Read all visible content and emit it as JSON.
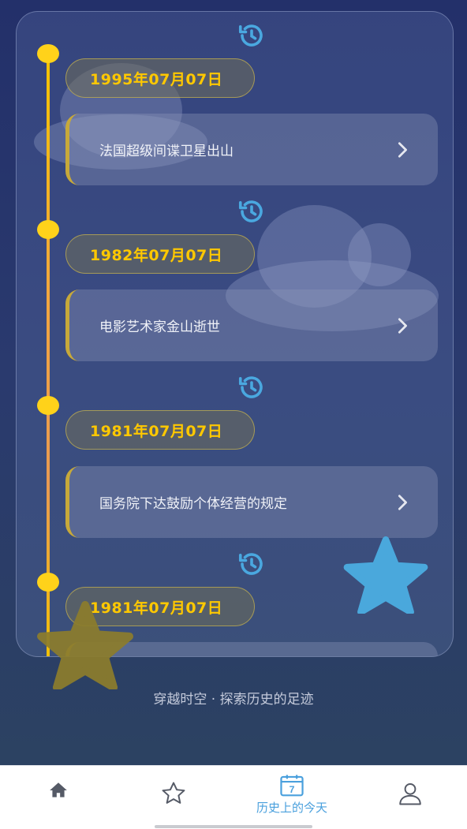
{
  "timeline": {
    "entries": [
      {
        "date": "1995年07月07日",
        "title": "法国超级间谍卫星出山"
      },
      {
        "date": "1982年07月07日",
        "title": "电影艺术家金山逝世"
      },
      {
        "date": "1981年07月07日",
        "title": "国务院下达鼓励个体经营的规定"
      },
      {
        "date": "1981年07月07日",
        "title": ""
      }
    ]
  },
  "footer": {
    "tagline": "穿越时空 · 探索历史的足迹"
  },
  "tabbar": {
    "tabs": [
      {
        "icon": "home-icon",
        "label": ""
      },
      {
        "icon": "star-icon",
        "label": ""
      },
      {
        "icon": "calendar-icon",
        "label": "历史上的今天",
        "calendar_day": "7",
        "active": true
      },
      {
        "icon": "user-icon",
        "label": ""
      }
    ]
  },
  "colors": {
    "accent_yellow": "#ffc800",
    "active_tab": "#4aa0dd",
    "star_blue": "#4aa8dc",
    "star_olive": "#8d7d2c"
  }
}
